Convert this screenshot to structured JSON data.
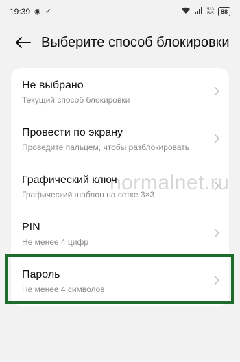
{
  "status_bar": {
    "time": "19:39",
    "battery": "88",
    "net_speed_value": "513",
    "net_speed_unit": "B/S"
  },
  "header": {
    "title": "Выберите способ блокировки э..."
  },
  "options": [
    {
      "title": "Не выбрано",
      "subtitle": "Текущий способ блокировки"
    },
    {
      "title": "Провести по экрану",
      "subtitle": "Проведите пальцем, чтобы разблокировать"
    },
    {
      "title": "Графический ключ",
      "subtitle": "Графический шаблон на сетке 3×3"
    },
    {
      "title": "PIN",
      "subtitle": "Не менее 4 цифр"
    },
    {
      "title": "Пароль",
      "subtitle": "Не менее 4 символов"
    }
  ],
  "watermark": "normalnet.ru",
  "colors": {
    "background": "#f2f2f2",
    "card": "#ffffff",
    "highlight": "#1e6b2e"
  }
}
